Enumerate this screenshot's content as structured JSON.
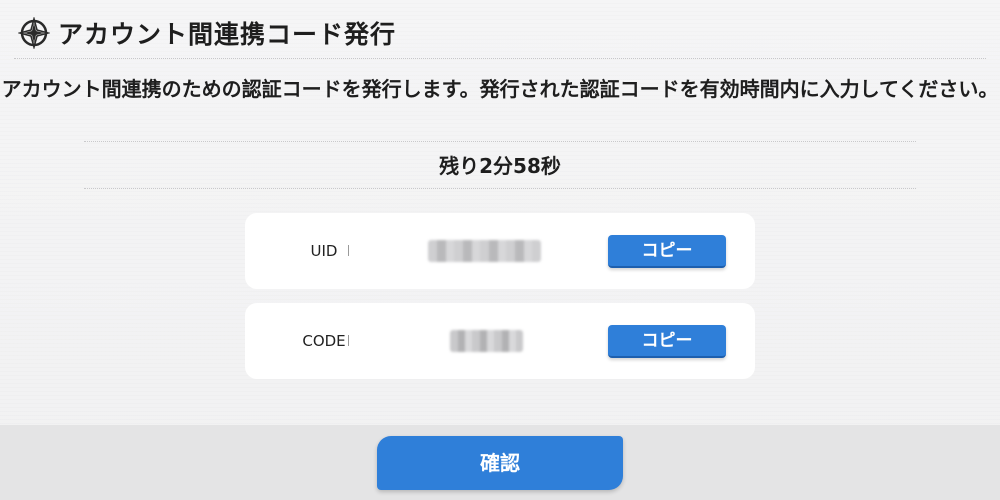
{
  "header": {
    "title": "アカウント間連携コード発行",
    "logo_icon": "compass-star-icon"
  },
  "description": "アカウント間連携のための認証コードを発行します。発行された認証コードを有効時間内に入力してください。",
  "timer": "残り2分58秒",
  "fields": [
    {
      "label": "UID",
      "copy_label": "コピー"
    },
    {
      "label": "CODE",
      "copy_label": "コピー"
    }
  ],
  "confirm_label": "確認",
  "colors": {
    "accent": "#2f7fd9",
    "background": "#f3f3f4",
    "card": "#ffffff",
    "footer": "#e4e4e5"
  }
}
